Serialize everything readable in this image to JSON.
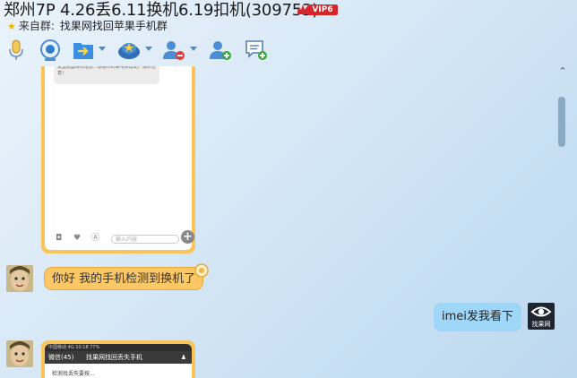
{
  "header": {
    "title": "郑州7P 4.26丢6.11换机6.19扣机(309753)",
    "vip_label": "VIP6",
    "from_label": "来自群:",
    "group_name": "找果网找回苹果手机群"
  },
  "toolbar": {
    "items": [
      {
        "name": "voice-icon"
      },
      {
        "name": "video-icon"
      },
      {
        "name": "transfer-file-icon"
      },
      {
        "name": "remote-assist-icon"
      },
      {
        "name": "remove-member-icon"
      },
      {
        "name": "add-member-icon"
      },
      {
        "name": "create-discussion-icon"
      }
    ]
  },
  "chat": {
    "phone1": {
      "message_text": "发送机器将你信息...感谢你的来电和帮助，请你注意！",
      "input_placeholder": "输入内容"
    },
    "msg_left": "你好 我的手机检测到换机了",
    "msg_right": "imei发我看下",
    "eye_avatar_label": "找果网",
    "phone2": {
      "status_text": "中国移动 4G     10:18     77%",
      "back_label": "微信(45)",
      "nav_title": "找果网找回丢失手机",
      "snippet": "检测找丢失要按..."
    }
  },
  "colors": {
    "bubble_left": "#fcc865",
    "bubble_right": "#9fd7f8",
    "vip_badge": "#d8242b"
  }
}
